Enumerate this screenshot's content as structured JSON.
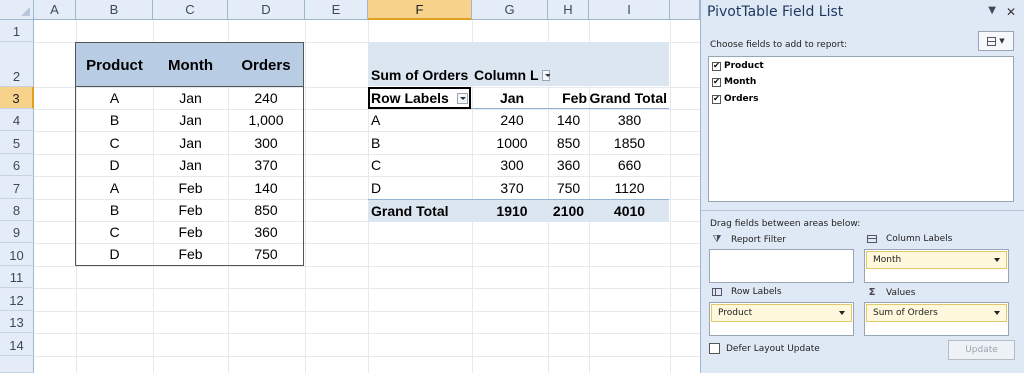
{
  "sheet": {
    "columns": [
      "A",
      "B",
      "C",
      "D",
      "E",
      "F",
      "G",
      "H",
      "I"
    ],
    "rows": [
      "1",
      "2",
      "3",
      "4",
      "5",
      "6",
      "7",
      "8",
      "9",
      "10",
      "11",
      "12",
      "13",
      "14"
    ],
    "selected_column": "F",
    "selected_row": "3"
  },
  "source_table": {
    "headers": [
      "Product",
      "Month",
      "Orders"
    ],
    "rows": [
      [
        "A",
        "Jan",
        "240"
      ],
      [
        "B",
        "Jan",
        "1,000"
      ],
      [
        "C",
        "Jan",
        "300"
      ],
      [
        "D",
        "Jan",
        "370"
      ],
      [
        "A",
        "Feb",
        "140"
      ],
      [
        "B",
        "Feb",
        "850"
      ],
      [
        "C",
        "Feb",
        "360"
      ],
      [
        "D",
        "Feb",
        "750"
      ]
    ]
  },
  "pivot": {
    "values_caption": "Sum of Orders",
    "column_labels_caption": "Column L",
    "row_labels_caption": "Row Labels",
    "col_headers": [
      "Jan",
      "Feb",
      "Grand Total"
    ],
    "rows": [
      [
        "A",
        "240",
        "140",
        "380"
      ],
      [
        "B",
        "1000",
        "850",
        "1850"
      ],
      [
        "C",
        "300",
        "360",
        "660"
      ],
      [
        "D",
        "370",
        "750",
        "1120"
      ]
    ],
    "grand_total": [
      "Grand Total",
      "1910",
      "2100",
      "4010"
    ]
  },
  "pane": {
    "title": "PivotTable Field List",
    "choose_text": "Choose fields to add to report:",
    "fields": [
      {
        "label": "Product",
        "checked": true
      },
      {
        "label": "Month",
        "checked": true
      },
      {
        "label": "Orders",
        "checked": true
      }
    ],
    "drag_text": "Drag fields between areas below:",
    "report_filter_label": "Report Filter",
    "column_labels_label": "Column Labels",
    "row_labels_label": "Row Labels",
    "values_label": "Values",
    "column_chip": "Month",
    "row_chip": "Product",
    "values_chip": "Sum of Orders",
    "defer_label": "Defer Layout Update",
    "update_label": "Update",
    "close_glyph": "✕",
    "menu_glyph": "▼",
    "check_glyph": "✔",
    "sigma_glyph": "Σ",
    "funnel_glyph": "⧩"
  }
}
